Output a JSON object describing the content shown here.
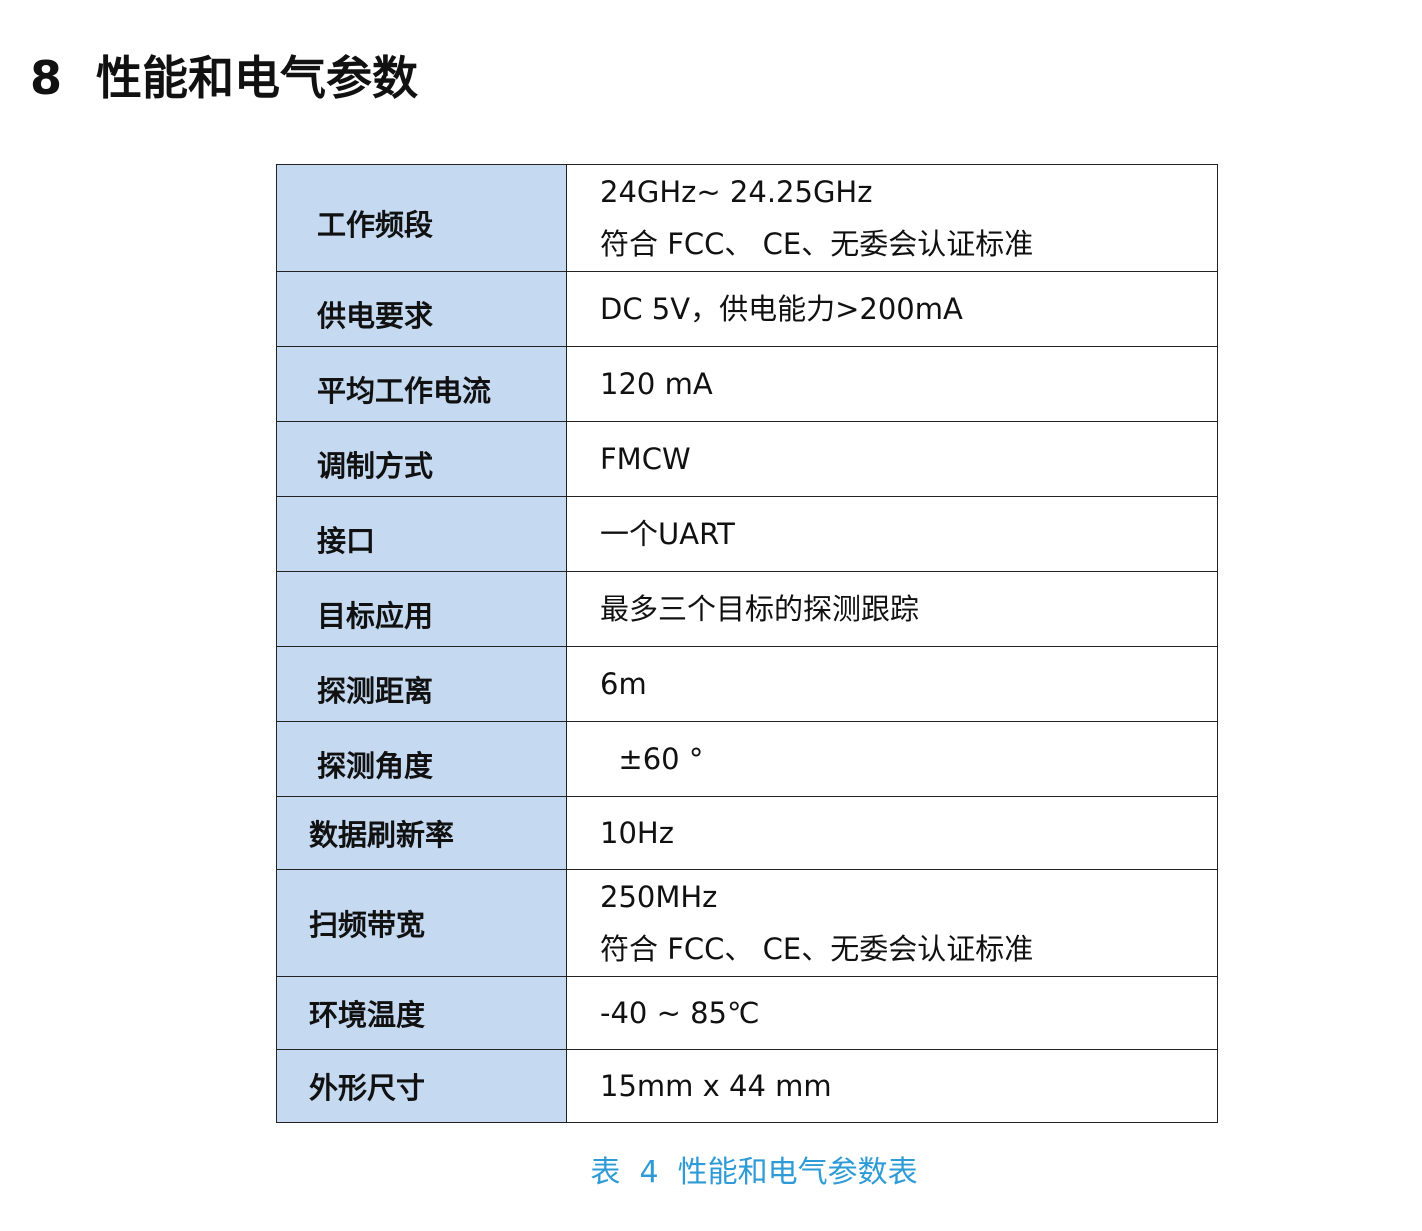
{
  "section": {
    "number": "8",
    "title": "性能和电气参数"
  },
  "table": {
    "rows": [
      {
        "label": "工作频段",
        "lines": [
          "24GHz~ 24.25GHz",
          "符合  FCC、  CE、无委会认证标准"
        ]
      },
      {
        "label": "供电要求",
        "lines": [
          "DC 5V，供电能力>200mA"
        ]
      },
      {
        "label": "平均工作电流",
        "lines": [
          "120 mA"
        ]
      },
      {
        "label": "调制方式",
        "lines": [
          "FMCW"
        ]
      },
      {
        "label": "接口",
        "lines": [
          "一个UART"
        ]
      },
      {
        "label": "目标应用",
        "lines": [
          "最多三个目标的探测跟踪"
        ]
      },
      {
        "label": "探测距离",
        "lines": [
          "6m"
        ]
      },
      {
        "label": "探测角度",
        "lines": [
          "  ±60 °"
        ]
      },
      {
        "label": "数据刷新率",
        "lines": [
          "10Hz"
        ]
      },
      {
        "label": "扫频带宽",
        "lines": [
          "250MHz",
          "符合  FCC、  CE、无委会认证标准"
        ]
      },
      {
        "label": "环境温度",
        "lines": [
          "-40 ~ 85℃"
        ]
      },
      {
        "label": "外形尺寸",
        "lines": [
          "15mm x 44 mm"
        ]
      }
    ]
  },
  "caption": {
    "text": "表  4  性能和电气参数表"
  },
  "colors": {
    "label_background": "#c5d9f1",
    "caption": "#2e9bd6"
  }
}
